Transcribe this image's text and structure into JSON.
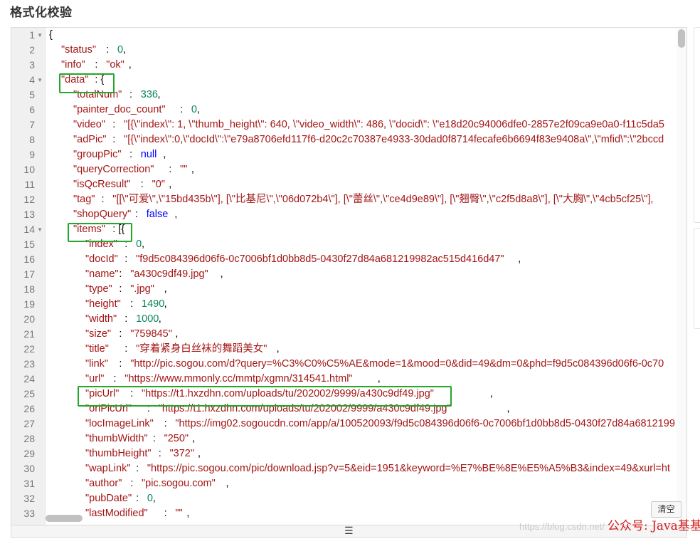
{
  "section": {
    "title": "格式化校验"
  },
  "editor": {
    "lines": [
      {
        "n": "1",
        "fold": true,
        "tokens": [
          {
            "c": 0,
            "t": "{",
            "k": "pun"
          }
        ]
      },
      {
        "n": "2",
        "fold": false,
        "tokens": [
          {
            "c": 1,
            "t": "\"status\"",
            "k": "key"
          },
          {
            "c": 9,
            "t": ": ",
            "k": "pun"
          },
          {
            "c": 11,
            "t": "0",
            "k": "num"
          },
          {
            "c": 12,
            "t": ",",
            "k": "pun"
          }
        ]
      },
      {
        "n": "3",
        "fold": false,
        "tokens": [
          {
            "c": 1,
            "t": "\"info\"",
            "k": "key"
          },
          {
            "c": 7,
            "t": ": ",
            "k": "pun"
          },
          {
            "c": 9,
            "t": "\"ok\"",
            "k": "str"
          },
          {
            "c": 13,
            "t": ",",
            "k": "pun"
          }
        ]
      },
      {
        "n": "4",
        "fold": true,
        "tokens": [
          {
            "c": 1,
            "t": "\"data\"",
            "k": "key"
          },
          {
            "c": 7,
            "t": ": {",
            "k": "pun"
          }
        ]
      },
      {
        "n": "5",
        "fold": false,
        "tokens": [
          {
            "c": 2,
            "t": "\"totalNum\"",
            "k": "key"
          },
          {
            "c": 12,
            "t": ": ",
            "k": "pun"
          },
          {
            "c": 14,
            "t": "336",
            "k": "num"
          },
          {
            "c": 17,
            "t": ",",
            "k": "pun"
          }
        ]
      },
      {
        "n": "6",
        "fold": false,
        "tokens": [
          {
            "c": 2,
            "t": "\"painter_doc_count\"",
            "k": "key"
          },
          {
            "c": 21,
            "t": ": ",
            "k": "pun"
          },
          {
            "c": 23,
            "t": "0",
            "k": "num"
          },
          {
            "c": 24,
            "t": ",",
            "k": "pun"
          }
        ]
      },
      {
        "n": "7",
        "fold": false,
        "tokens": [
          {
            "c": 2,
            "t": "\"video\"",
            "k": "key"
          },
          {
            "c": 9,
            "t": ": ",
            "k": "pun"
          },
          {
            "c": 11,
            "t": "\"[{\\\"index\\\": 1, \\\"thumb_height\\\": 640, \\\"video_width\\\": 486, \\\"docid\\\": \\\"e18d20c94006dfe0-2857e2f09ca9e0a0-f11c5da5",
            "k": "str"
          }
        ]
      },
      {
        "n": "8",
        "fold": false,
        "tokens": [
          {
            "c": 2,
            "t": "\"adPic\"",
            "k": "key"
          },
          {
            "c": 9,
            "t": ": ",
            "k": "pun"
          },
          {
            "c": 11,
            "t": "\"[{\\\"index\\\":0,\\\"docId\\\":\\\"e79a8706efd117f6-d20c2c70387e4933-30dad0f8714fecafe6b6694f83e9408a\\\",\\\"mfid\\\":\\\"2bccd",
            "k": "str"
          }
        ]
      },
      {
        "n": "9",
        "fold": false,
        "tokens": [
          {
            "c": 2,
            "t": "\"groupPic\"",
            "k": "key"
          },
          {
            "c": 12,
            "t": ": ",
            "k": "pun"
          },
          {
            "c": 14,
            "t": "null",
            "k": "kw"
          },
          {
            "c": 18,
            "t": ",",
            "k": "pun"
          }
        ]
      },
      {
        "n": "10",
        "fold": false,
        "tokens": [
          {
            "c": 2,
            "t": "\"queryCorrection\"",
            "k": "key"
          },
          {
            "c": 19,
            "t": ": ",
            "k": "pun"
          },
          {
            "c": 21,
            "t": "\"\"",
            "k": "str"
          },
          {
            "c": 23,
            "t": ",",
            "k": "pun"
          }
        ]
      },
      {
        "n": "11",
        "fold": false,
        "tokens": [
          {
            "c": 2,
            "t": "\"isQcResult\"",
            "k": "key"
          },
          {
            "c": 14,
            "t": ": ",
            "k": "pun"
          },
          {
            "c": 16,
            "t": "\"0\"",
            "k": "str"
          },
          {
            "c": 19,
            "t": ",",
            "k": "pun"
          }
        ]
      },
      {
        "n": "12",
        "fold": false,
        "tokens": [
          {
            "c": 2,
            "t": "\"tag\"",
            "k": "key"
          },
          {
            "c": 7,
            "t": ": ",
            "k": "pun"
          },
          {
            "c": 9,
            "t": "\"[[\\\"可爱\\\",\\\"15bd435b\\\"], [\\\"比基尼\\\",\\\"06d072b4\\\"], [\\\"蕾丝\\\",\\\"ce4d9e89\\\"], [\\\"翘臀\\\",\\\"c2f5d8a8\\\"], [\\\"大胸\\\",\\\"4cb5cf25\\\"],",
            "k": "str"
          }
        ]
      },
      {
        "n": "13",
        "fold": false,
        "tokens": [
          {
            "c": 2,
            "t": "\"shopQuery\"",
            "k": "key"
          },
          {
            "c": 13,
            "t": ": ",
            "k": "pun"
          },
          {
            "c": 15,
            "t": "false",
            "k": "kw"
          },
          {
            "c": 20,
            "t": ",",
            "k": "pun"
          }
        ]
      },
      {
        "n": "14",
        "fold": true,
        "tokens": [
          {
            "c": 2,
            "t": "\"items\"",
            "k": "key"
          },
          {
            "c": 9,
            "t": ": [{",
            "k": "pun"
          }
        ]
      },
      {
        "n": "15",
        "fold": false,
        "tokens": [
          {
            "c": 3,
            "t": "\"index\"",
            "k": "key"
          },
          {
            "c": 10,
            "t": ": ",
            "k": "pun"
          },
          {
            "c": 12,
            "t": "0",
            "k": "num"
          },
          {
            "c": 13,
            "t": ",",
            "k": "pun"
          }
        ]
      },
      {
        "n": "16",
        "fold": false,
        "tokens": [
          {
            "c": 3,
            "t": "\"docId\"",
            "k": "key"
          },
          {
            "c": 10,
            "t": ": ",
            "k": "pun"
          },
          {
            "c": 12,
            "t": "\"f9d5c084396d06f6-0c7006bf1d0bb8d5-0430f27d84a681219982ac515d416d47\"",
            "k": "str"
          },
          {
            "c": 80,
            "t": ",",
            "k": "pun"
          }
        ]
      },
      {
        "n": "17",
        "fold": false,
        "tokens": [
          {
            "c": 3,
            "t": "\"name\"",
            "k": "key"
          },
          {
            "c": 9,
            "t": ": ",
            "k": "pun"
          },
          {
            "c": 11,
            "t": "\"a430c9df49.jpg\"",
            "k": "str"
          },
          {
            "c": 27,
            "t": ",",
            "k": "pun"
          }
        ]
      },
      {
        "n": "18",
        "fold": false,
        "tokens": [
          {
            "c": 3,
            "t": "\"type\"",
            "k": "key"
          },
          {
            "c": 9,
            "t": ": ",
            "k": "pun"
          },
          {
            "c": 11,
            "t": "\".jpg\"",
            "k": "str"
          },
          {
            "c": 17,
            "t": ",",
            "k": "pun"
          }
        ]
      },
      {
        "n": "19",
        "fold": false,
        "tokens": [
          {
            "c": 3,
            "t": "\"height\"",
            "k": "key"
          },
          {
            "c": 11,
            "t": ": ",
            "k": "pun"
          },
          {
            "c": 13,
            "t": "1490",
            "k": "num"
          },
          {
            "c": 17,
            "t": ",",
            "k": "pun"
          }
        ]
      },
      {
        "n": "20",
        "fold": false,
        "tokens": [
          {
            "c": 3,
            "t": "\"width\"",
            "k": "key"
          },
          {
            "c": 10,
            "t": ": ",
            "k": "pun"
          },
          {
            "c": 12,
            "t": "1000",
            "k": "num"
          },
          {
            "c": 16,
            "t": ",",
            "k": "pun"
          }
        ]
      },
      {
        "n": "21",
        "fold": false,
        "tokens": [
          {
            "c": 3,
            "t": "\"size\"",
            "k": "key"
          },
          {
            "c": 9,
            "t": ": ",
            "k": "pun"
          },
          {
            "c": 11,
            "t": "\"759845\"",
            "k": "str"
          },
          {
            "c": 19,
            "t": ",",
            "k": "pun"
          }
        ]
      },
      {
        "n": "22",
        "fold": false,
        "tokens": [
          {
            "c": 3,
            "t": "\"title\"",
            "k": "key"
          },
          {
            "c": 10,
            "t": ": ",
            "k": "pun"
          },
          {
            "c": 12,
            "t": "\"穿着紧身白丝袜的舞蹈美女\"",
            "k": "str"
          },
          {
            "c": 37,
            "t": ",",
            "k": "pun"
          }
        ]
      },
      {
        "n": "23",
        "fold": false,
        "tokens": [
          {
            "c": 3,
            "t": "\"link\"",
            "k": "key"
          },
          {
            "c": 9,
            "t": ": ",
            "k": "pun"
          },
          {
            "c": 11,
            "t": "\"http://pic.sogou.com/d?query=%C3%C0%C5%AE&mode=1&mood=0&did=49&dm=0&phd=f9d5c084396d06f6-0c70",
            "k": "str"
          }
        ]
      },
      {
        "n": "24",
        "fold": false,
        "tokens": [
          {
            "c": 3,
            "t": "\"url\"",
            "k": "key"
          },
          {
            "c": 8,
            "t": ": ",
            "k": "pun"
          },
          {
            "c": 10,
            "t": "\"https://www.mmonly.cc/mmtp/xgmn/314541.html\"",
            "k": "str"
          },
          {
            "c": 55,
            "t": ",",
            "k": "pun"
          }
        ]
      },
      {
        "n": "25",
        "fold": false,
        "tokens": [
          {
            "c": 3,
            "t": "\"picUrl\"",
            "k": "key"
          },
          {
            "c": 11,
            "t": ": ",
            "k": "pun"
          },
          {
            "c": 13,
            "t": "\"https://t1.hxzdhn.com/uploads/tu/202002/9999/a430c9df49.jpg\"",
            "k": "str"
          },
          {
            "c": 75,
            "t": ",",
            "k": "pun"
          }
        ]
      },
      {
        "n": "26",
        "fold": false,
        "tokens": [
          {
            "c": 3,
            "t": "\"oriPicUrl\"",
            "k": "key"
          },
          {
            "c": 14,
            "t": ": ",
            "k": "pun"
          },
          {
            "c": 16,
            "t": "\"https://t1.hxzdhn.com/uploads/tu/202002/9999/a430c9df49.jpg\"",
            "k": "str"
          },
          {
            "c": 78,
            "t": ",",
            "k": "pun"
          }
        ]
      },
      {
        "n": "27",
        "fold": false,
        "tokens": [
          {
            "c": 3,
            "t": "\"locImageLink\"",
            "k": "key"
          },
          {
            "c": 17,
            "t": ": ",
            "k": "pun"
          },
          {
            "c": 19,
            "t": "\"https://img02.sogoucdn.com/app/a/100520093/f9d5c084396d06f6-0c7006bf1d0bb8d5-0430f27d84a6812199",
            "k": "str"
          }
        ]
      },
      {
        "n": "28",
        "fold": false,
        "tokens": [
          {
            "c": 3,
            "t": "\"thumbWidth\"",
            "k": "key"
          },
          {
            "c": 15,
            "t": ": ",
            "k": "pun"
          },
          {
            "c": 17,
            "t": "\"250\"",
            "k": "str"
          },
          {
            "c": 22,
            "t": ",",
            "k": "pun"
          }
        ]
      },
      {
        "n": "29",
        "fold": false,
        "tokens": [
          {
            "c": 3,
            "t": "\"thumbHeight\"",
            "k": "key"
          },
          {
            "c": 16,
            "t": ": ",
            "k": "pun"
          },
          {
            "c": 18,
            "t": "\"372\"",
            "k": "str"
          },
          {
            "c": 23,
            "t": ",",
            "k": "pun"
          }
        ]
      },
      {
        "n": "30",
        "fold": false,
        "tokens": [
          {
            "c": 3,
            "t": "\"wapLink\"",
            "k": "key"
          },
          {
            "c": 12,
            "t": ": ",
            "k": "pun"
          },
          {
            "c": 14,
            "t": "\"https://pic.sogou.com/pic/download.jsp?v=5&eid=1951&keyword=%E7%BE%8E%E5%A5%B3&index=49&xurl=ht",
            "k": "str"
          }
        ]
      },
      {
        "n": "31",
        "fold": false,
        "tokens": [
          {
            "c": 3,
            "t": "\"author\"",
            "k": "key"
          },
          {
            "c": 11,
            "t": ": ",
            "k": "pun"
          },
          {
            "c": 13,
            "t": "\"pic.sogou.com\"",
            "k": "str"
          },
          {
            "c": 28,
            "t": ",",
            "k": "pun"
          }
        ]
      },
      {
        "n": "32",
        "fold": false,
        "tokens": [
          {
            "c": 3,
            "t": "\"pubDate\"",
            "k": "key"
          },
          {
            "c": 12,
            "t": ": ",
            "k": "pun"
          },
          {
            "c": 14,
            "t": "0",
            "k": "num"
          },
          {
            "c": 15,
            "t": ",",
            "k": "pun"
          }
        ]
      },
      {
        "n": "33",
        "fold": false,
        "tokens": [
          {
            "c": 3,
            "t": "\"lastModified\"",
            "k": "key"
          },
          {
            "c": 17,
            "t": ": ",
            "k": "pun"
          },
          {
            "c": 19,
            "t": "\"\"",
            "k": "str"
          },
          {
            "c": 21,
            "t": ",",
            "k": "pun"
          }
        ]
      }
    ],
    "clear_label": "清空"
  },
  "watermark": {
    "url": "https://blog.csdn.net/",
    "text": "公众号: Java基基"
  },
  "colors": {
    "highlight_box": "#22a82a",
    "json_key": "#a31515",
    "json_number": "#098658",
    "json_keyword": "#0000ff"
  }
}
